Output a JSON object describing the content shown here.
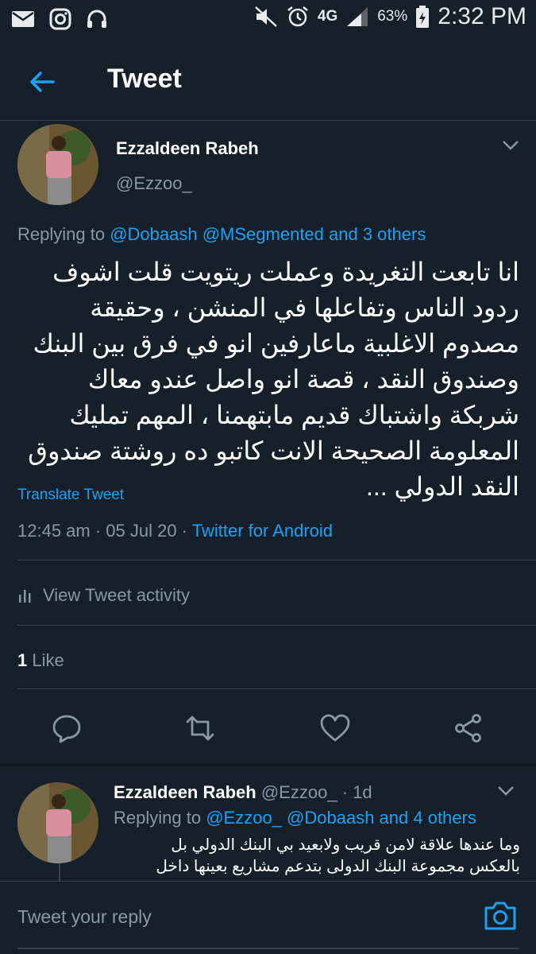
{
  "status_bar": {
    "signal_label": "4G",
    "battery": "63%",
    "time": "2:32 PM"
  },
  "header": {
    "title": "Tweet"
  },
  "tweet": {
    "author_name": "Ezzaldeen Rabeh",
    "author_handle": "@Ezzoo_",
    "replying_prefix": "Replying to",
    "replying_mentions": "@Dobaash @MSegmented and 3 others",
    "text": "انا تابعت التغريدة وعملت ريتويت قلت اشوف ردود الناس وتفاعلها في المنشن ، وحقيقة مصدوم الاغلبية ماعارفين انو في فرق بين البنك وصندوق النقد ، قصة انو واصل عندو معاك شربكة واشتباك قديم مابتهمنا ، المهم تمليك المعلومة الصحيحة الانت كاتبو ده روشتة صندوق النقد الدولي ...",
    "translate_label": "Translate Tweet",
    "timestamp": "12:45 am · 05 Jul 20 · ",
    "source": "Twitter for Android",
    "activity_label": "View Tweet activity",
    "likes_count": "1",
    "likes_label": "Like"
  },
  "reply": {
    "author_name": "Ezzaldeen Rabeh",
    "author_handle": "@Ezzoo_",
    "age": "· 1d",
    "replying_prefix": "Replying to",
    "replying_mentions": "@Ezzoo_ @Dobaash and 4 others",
    "text_line1": "وما عندها علاقة لامن قريب ولابعيد بي البنك الدولي بل",
    "text_line2": "بالعكس مجموعة البنك الدولى بتدعم مشاريع بعينها داخل"
  },
  "compose": {
    "placeholder": "Tweet your reply"
  },
  "colors": {
    "background": "#15202b",
    "accent": "#1da1f2",
    "muted": "#8899a6",
    "divider": "#38444d"
  }
}
